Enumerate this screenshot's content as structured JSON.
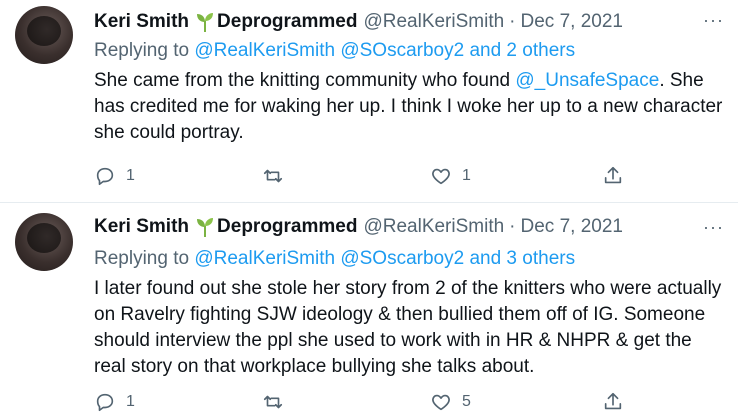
{
  "tweets": [
    {
      "author": {
        "name": "Keri Smith",
        "label": "Deprogrammed",
        "handle": "@RealKeriSmith",
        "separator": "·",
        "date": "Dec 7, 2021"
      },
      "reply": {
        "prefix": "Replying to ",
        "mentions": "@RealKeriSmith @SOscarboy2 and 2 others"
      },
      "body": {
        "before": "She came from the knitting community who found ",
        "mention": "@_UnsafeSpace",
        "after": ". She has credited me for waking her up. I think I woke her up to a new character she could portray."
      },
      "actions": {
        "reply_count": "1",
        "retweet_count": "",
        "like_count": "1"
      }
    },
    {
      "author": {
        "name": "Keri Smith",
        "label": "Deprogrammed",
        "handle": "@RealKeriSmith",
        "separator": "·",
        "date": "Dec 7, 2021"
      },
      "reply": {
        "prefix": "Replying to ",
        "mentions": "@RealKeriSmith @SOscarboy2 and 3 others"
      },
      "body": {
        "text": "I later found out she stole her story from 2 of the knitters who were actually on Ravelry fighting SJW ideology & then bullied them off of IG. Someone should interview the ppl she used to work with in HR & NHPR & get the real story on that workplace bullying she talks about."
      },
      "actions": {
        "reply_count": "1",
        "retweet_count": "",
        "like_count": "5"
      }
    }
  ],
  "more_label": "···",
  "icons": {
    "sprout": "sprout-icon",
    "reply": "reply-icon",
    "retweet": "retweet-icon",
    "like": "heart-icon",
    "share": "share-icon",
    "more": "more-icon"
  },
  "colors": {
    "text": "#0f1419",
    "secondary": "#536471",
    "link": "#1d9bf0",
    "sprout": "#7bb342"
  }
}
